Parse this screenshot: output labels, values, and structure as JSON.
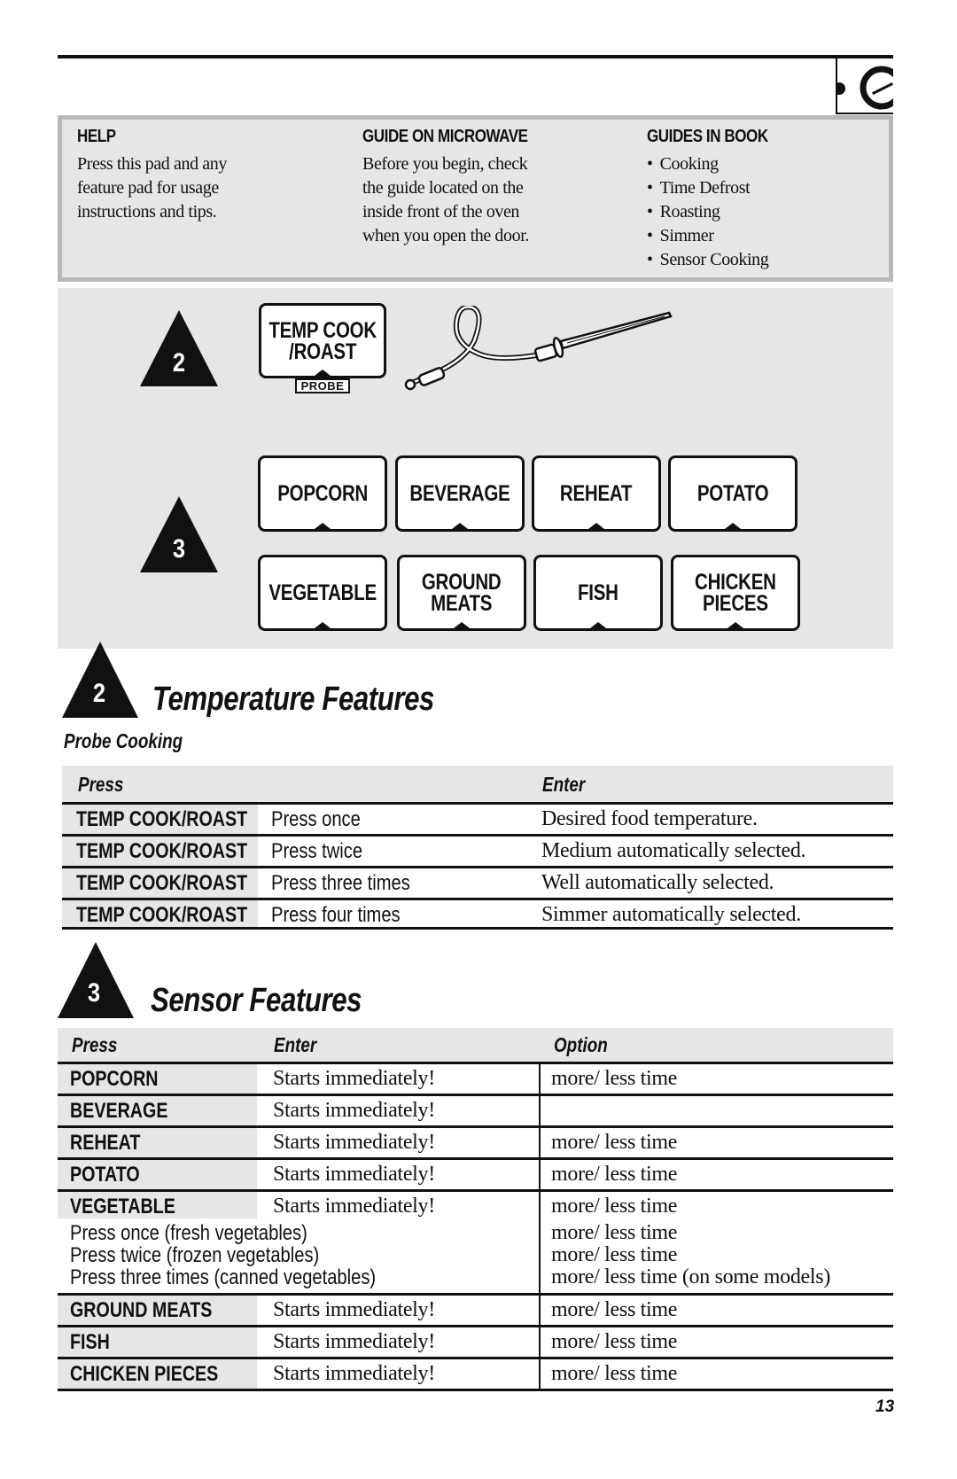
{
  "header": {
    "section_tab_icon": "microwave-dial-icon"
  },
  "info_box": {
    "help": {
      "title": "HELP",
      "lines": [
        "Press this pad and any",
        "feature pad for usage",
        "instructions and tips."
      ]
    },
    "guide_on_microwave": {
      "title": "GUIDE ON MICROWAVE",
      "lines": [
        "Before you begin, check",
        "the guide located on the",
        "inside front of the oven",
        "when you open the door."
      ]
    },
    "guides_in_book": {
      "title": "GUIDES IN BOOK",
      "items": [
        "Cooking",
        "Time Defrost",
        "Roasting",
        "Simmer",
        "Sensor Cooking"
      ]
    }
  },
  "keypad": {
    "step2_number": "2",
    "step3_number": "3",
    "temp_pad": {
      "line1": "TEMP COOK",
      "line2": "/ROAST",
      "tag": "PROBE"
    },
    "probe_icon": "temperature-probe-icon",
    "sensor_pads_row1": [
      "POPCORN",
      "BEVERAGE",
      "REHEAT",
      "POTATO"
    ],
    "sensor_pads_row2": [
      {
        "line1": "VEGETABLE",
        "line2": ""
      },
      {
        "line1": "GROUND",
        "line2": "MEATS"
      },
      {
        "line1": "FISH",
        "line2": ""
      },
      {
        "line1": "CHICKEN",
        "line2": "PIECES"
      }
    ]
  },
  "temperature": {
    "number": "2",
    "title": "Temperature Features",
    "subtitle": "Probe Cooking",
    "headers": {
      "press": "Press",
      "enter": "Enter"
    },
    "rows": [
      {
        "key": "TEMP COOK/ROAST",
        "action": "Press once",
        "enter": "Desired food temperature."
      },
      {
        "key": "TEMP COOK/ROAST",
        "action": "Press twice",
        "enter": "Medium automatically selected."
      },
      {
        "key": "TEMP COOK/ROAST",
        "action": "Press three times",
        "enter": "Well automatically selected."
      },
      {
        "key": "TEMP COOK/ROAST",
        "action": "Press four times",
        "enter": "Simmer automatically selected."
      }
    ]
  },
  "sensor": {
    "number": "3",
    "title": "Sensor Features",
    "headers": {
      "press": "Press",
      "enter": "Enter",
      "option": "Option"
    },
    "rows": [
      {
        "key": "POPCORN",
        "enter": "Starts immediately!",
        "option": "more/ less time"
      },
      {
        "key": "BEVERAGE",
        "enter": "Starts immediately!",
        "option": ""
      },
      {
        "key": "REHEAT",
        "enter": "Starts immediately!",
        "option": "more/ less time"
      },
      {
        "key": "POTATO",
        "enter": "Starts immediately!",
        "option": "more/ less time"
      },
      {
        "key": "VEGETABLE",
        "enter": "Starts immediately!",
        "option": "more/ less time"
      },
      {
        "key": "GROUND MEATS",
        "enter": "Starts immediately!",
        "option": "more/ less time"
      },
      {
        "key": "FISH",
        "enter": "Starts immediately!",
        "option": "more/ less time"
      },
      {
        "key": "CHICKEN PIECES",
        "enter": "Starts immediately!",
        "option": "more/ less time"
      }
    ],
    "vegetable_sub": [
      {
        "text": "Press once (fresh vegetables)",
        "option": "more/ less time"
      },
      {
        "text": "Press twice (frozen vegetables)",
        "option": "more/ less time"
      },
      {
        "text": "Press three times (canned vegetables)",
        "option": "more/ less time (on some models)"
      }
    ]
  },
  "footer": {
    "page_number": "13"
  }
}
